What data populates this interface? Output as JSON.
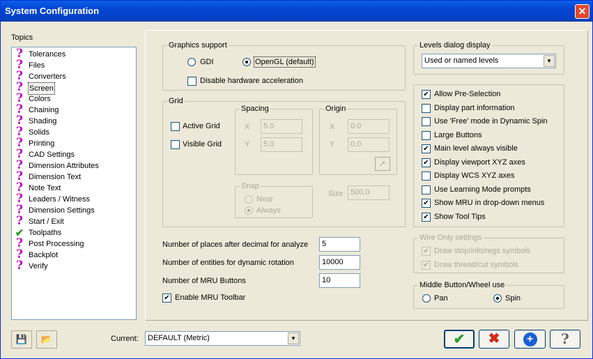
{
  "window": {
    "title": "System Configuration"
  },
  "topics": {
    "label": "Topics",
    "items": [
      {
        "label": "Tolerances",
        "icon": "question-icon"
      },
      {
        "label": "Files",
        "icon": "question-icon"
      },
      {
        "label": "Converters",
        "icon": "question-icon"
      },
      {
        "label": "Screen",
        "icon": "question-icon",
        "selected": true
      },
      {
        "label": "Colors",
        "icon": "question-icon"
      },
      {
        "label": "Chaining",
        "icon": "question-icon"
      },
      {
        "label": "Shading",
        "icon": "question-icon"
      },
      {
        "label": "Solids",
        "icon": "question-icon"
      },
      {
        "label": "Printing",
        "icon": "question-icon"
      },
      {
        "label": "CAD Settings",
        "icon": "question-icon"
      },
      {
        "label": "Dimension Attributes",
        "icon": "question-icon"
      },
      {
        "label": "Dimension Text",
        "icon": "question-icon"
      },
      {
        "label": "Note Text",
        "icon": "question-icon"
      },
      {
        "label": "Leaders / Witness",
        "icon": "question-icon"
      },
      {
        "label": "Dimension Settings",
        "icon": "question-icon"
      },
      {
        "label": "Start / Exit",
        "icon": "question-icon"
      },
      {
        "label": "Toolpaths",
        "icon": "check-icon"
      },
      {
        "label": "Post Processing",
        "icon": "question-icon"
      },
      {
        "label": "Backplot",
        "icon": "question-icon"
      },
      {
        "label": "Verify",
        "icon": "question-icon"
      }
    ]
  },
  "graphics": {
    "title": "Graphics support",
    "gdi": "GDI",
    "opengl": "OpenGL (default)",
    "disable_hw": "Disable hardware acceleration"
  },
  "grid": {
    "title": "Grid",
    "active_grid": "Active Grid",
    "visible_grid": "Visible Grid",
    "spacing": {
      "title": "Spacing",
      "x_label": "X",
      "x_value": "5.0",
      "y_label": "Y",
      "y_value": "5.0"
    },
    "origin": {
      "title": "Origin",
      "x_label": "X",
      "x_value": "0.0",
      "y_label": "Y",
      "y_value": "0.0"
    },
    "snap": {
      "title": "Snap",
      "near": "Near",
      "always": "Always"
    },
    "size_label": "Size",
    "size_value": "500.0"
  },
  "numbers": {
    "decimal_label": "Number of places after decimal for analyze",
    "decimal_value": "5",
    "entities_label": "Number of entities for dynamic rotation",
    "entities_value": "10000",
    "mru_label": "Number of MRU Buttons",
    "mru_value": "10",
    "enable_mru": "Enable MRU Toolbar"
  },
  "levels": {
    "title": "Levels dialog display",
    "value": "Used or named levels"
  },
  "options": [
    {
      "label": "Allow Pre-Selection",
      "checked": true
    },
    {
      "label": "Display part information",
      "checked": false
    },
    {
      "label": "Use 'Free' mode in Dynamic Spin",
      "checked": false
    },
    {
      "label": "Large Buttons",
      "checked": false
    },
    {
      "label": "Main level always visible",
      "checked": true
    },
    {
      "label": "Display viewport XYZ axes",
      "checked": true
    },
    {
      "label": "Display WCS XYZ axes",
      "checked": false
    },
    {
      "label": "Use Learning Mode prompts",
      "checked": false
    },
    {
      "label": "Show MRU in drop-down menus",
      "checked": true
    },
    {
      "label": "Show Tool Tips",
      "checked": true
    }
  ],
  "wire": {
    "title": "Wire Only settings",
    "stop_symbols": "Draw stop/info/regs symbols",
    "thread_symbols": "Draw thread/cut symbols"
  },
  "middle": {
    "title": "Middle Button/Wheel use",
    "pan": "Pan",
    "spin": "Spin"
  },
  "footer": {
    "current_label": "Current:",
    "current_value": "DEFAULT (Metric)"
  },
  "colors": {
    "title_bar": "#0545d3",
    "ok_green": "#2a9d2a",
    "cancel_red": "#d42a1a",
    "help_blue": "#1a5fd4",
    "question_magenta": "#c000c0"
  }
}
